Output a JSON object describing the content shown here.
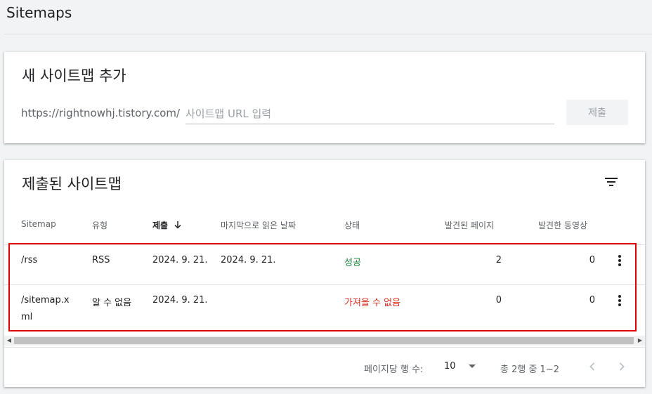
{
  "page": {
    "title": "Sitemaps"
  },
  "add_card": {
    "heading": "새 사이트맵 추가",
    "url_prefix": "https://rightnowhj.tistory.com/",
    "input_placeholder": "사이트맵 URL 입력",
    "input_value": "",
    "submit_label": "제출"
  },
  "list_card": {
    "heading": "제출된 사이트맵",
    "columns": [
      "Sitemap",
      "유형",
      "제출",
      "마지막으로 읽은 날짜",
      "상태",
      "발견된 페이지",
      "발견한 동영상"
    ],
    "sorted_column": "제출",
    "sort_direction": "descending",
    "rows": [
      {
        "sitemap": "/rss",
        "type": "RSS",
        "submitted": "2024. 9. 21.",
        "last_read": "2024. 9. 21.",
        "status": "성공",
        "status_kind": "success",
        "pages": "2",
        "videos": "0"
      },
      {
        "sitemap": "/sitemap.xml",
        "type": "알 수 없음",
        "submitted": "2024. 9. 21.",
        "last_read": "",
        "status": "가져올 수 없음",
        "status_kind": "error",
        "pages": "0",
        "videos": "0"
      }
    ],
    "pagination": {
      "rows_per_page_label": "페이지당 행 수:",
      "rows_per_page": "10",
      "range_text": "총 2행 중 1~2"
    }
  },
  "colors": {
    "success": "#188038",
    "error": "#d93025",
    "highlight": "#e00000"
  },
  "icons": [
    "filter-icon",
    "arrow-down-icon",
    "more-vert-icon",
    "chevron-left-icon",
    "chevron-right-icon"
  ]
}
